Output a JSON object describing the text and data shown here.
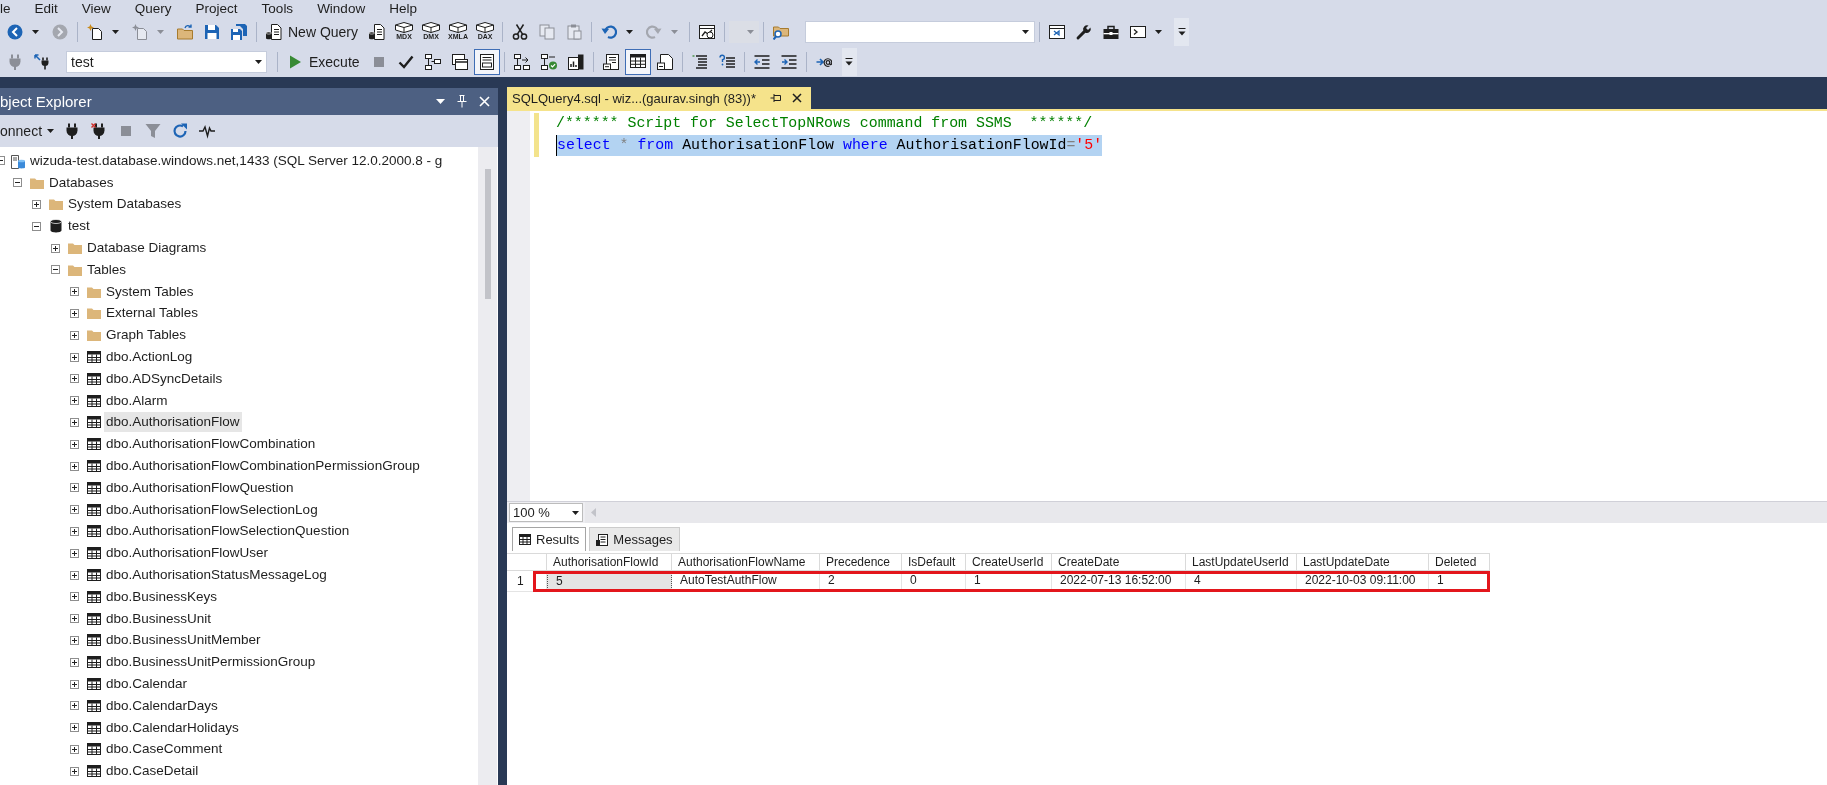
{
  "menu_bar": {
    "items": [
      "le",
      "Edit",
      "View",
      "Query",
      "Project",
      "Tools",
      "Window",
      "Help"
    ]
  },
  "toolbar_1": {
    "groups": [
      [
        {
          "kind": "back",
          "disabled": false
        },
        {
          "kind": "forward",
          "disabled": true
        }
      ],
      [
        {
          "kind": "newproject",
          "disabled": false
        },
        {
          "kind": "additem",
          "disabled": true
        },
        {
          "kind": "open",
          "disabled": false
        },
        {
          "kind": "save",
          "disabled": false
        },
        {
          "kind": "saveall",
          "disabled": false
        }
      ],
      [
        {
          "kind": "newquery",
          "label": "New Query",
          "disabled": false
        },
        {
          "kind": "query",
          "disabled": false
        },
        {
          "kind": "cube",
          "label": "MDX",
          "disabled": false
        },
        {
          "kind": "cube",
          "label": "DMX",
          "disabled": false
        },
        {
          "kind": "cube",
          "label": "XMLA",
          "disabled": false
        },
        {
          "kind": "cube",
          "label": "DAX",
          "disabled": false
        }
      ],
      [
        {
          "kind": "cut",
          "disabled": false
        },
        {
          "kind": "copy",
          "disabled": true
        },
        {
          "kind": "paste",
          "disabled": true
        }
      ],
      [
        {
          "kind": "undo",
          "disabled": false
        },
        {
          "kind": "redo",
          "disabled": true
        }
      ],
      [
        {
          "kind": "monitor",
          "disabled": false
        }
      ],
      [
        {
          "kind": "dropdown",
          "disabled": true
        }
      ],
      [
        {
          "kind": "find",
          "disabled": false
        },
        {
          "kind": "combo",
          "disabled": false
        }
      ],
      [
        {
          "kind": "window",
          "disabled": false
        },
        {
          "kind": "wrench",
          "disabled": false
        },
        {
          "kind": "toolbox",
          "disabled": false
        },
        {
          "kind": "terminal",
          "disabled": false
        }
      ]
    ]
  },
  "toolbar_2": {
    "groups": [
      [
        {
          "kind": "connect",
          "disabled": true,
          "on": false
        },
        {
          "kind": "changeconnection",
          "disabled": false,
          "on": false
        },
        {
          "kind": "database",
          "value": "test",
          "disabled": false
        }
      ],
      [
        {
          "kind": "execute",
          "label": "Execute",
          "disabled": false,
          "on": false
        },
        {
          "kind": "stop",
          "disabled": true,
          "on": false
        },
        {
          "kind": "parse",
          "disabled": false,
          "on": false
        },
        {
          "kind": "plan",
          "disabled": false,
          "on": false
        },
        {
          "kind": "options",
          "disabled": false,
          "on": false
        },
        {
          "kind": "intellisense",
          "disabled": false,
          "on": true
        }
      ],
      [
        {
          "kind": "actualplan",
          "disabled": false,
          "on": false
        },
        {
          "kind": "livestats",
          "disabled": false,
          "on": false
        },
        {
          "kind": "clientstats",
          "disabled": false,
          "on": false
        }
      ],
      [
        {
          "kind": "totext",
          "disabled": false,
          "on": false
        },
        {
          "kind": "togrid",
          "disabled": false,
          "on": true
        },
        {
          "kind": "tofile",
          "disabled": false,
          "on": false
        }
      ],
      [
        {
          "kind": "comment",
          "disabled": false,
          "on": false
        },
        {
          "kind": "uncomment",
          "disabled": false,
          "on": false
        }
      ],
      [
        {
          "kind": "outdent",
          "disabled": false,
          "on": false
        },
        {
          "kind": "indent",
          "disabled": false,
          "on": false
        }
      ],
      [
        {
          "kind": "template",
          "disabled": false,
          "on": false
        }
      ]
    ]
  },
  "object_explorer": {
    "title": "bject Explorer",
    "toolbar": {
      "connect_label": "onnect",
      "items": [
        {
          "kind": "connect",
          "disabled": false
        },
        {
          "kind": "disconnect",
          "disabled": false
        },
        {
          "kind": "stop",
          "disabled": true
        },
        {
          "kind": "filter",
          "disabled": true
        },
        {
          "kind": "refresh",
          "disabled": false
        },
        {
          "kind": "activity",
          "disabled": false
        }
      ]
    },
    "tree": [
      {
        "label": "wizuda-test.database.windows.net,1433 (SQL Server 12.0.2000.8 - g",
        "kind": "server",
        "expanded": true,
        "selected": false,
        "children": [
          {
            "label": "Databases",
            "kind": "folder",
            "expanded": true,
            "selected": false,
            "children": [
              {
                "label": "System Databases",
                "kind": "folder",
                "expanded": false,
                "selected": false
              },
              {
                "label": "test",
                "kind": "database",
                "expanded": true,
                "selected": false,
                "children": [
                  {
                    "label": "Database Diagrams",
                    "kind": "folder",
                    "expanded": false,
                    "selected": false
                  },
                  {
                    "label": "Tables",
                    "kind": "folder",
                    "expanded": true,
                    "selected": false,
                    "children": [
                      {
                        "label": "System Tables",
                        "kind": "folder",
                        "expanded": false,
                        "selected": false
                      },
                      {
                        "label": "External Tables",
                        "kind": "folder",
                        "expanded": false,
                        "selected": false
                      },
                      {
                        "label": "Graph Tables",
                        "kind": "folder",
                        "expanded": false,
                        "selected": false
                      },
                      {
                        "label": "dbo.ActionLog",
                        "kind": "table",
                        "expanded": false,
                        "selected": false
                      },
                      {
                        "label": "dbo.ADSyncDetails",
                        "kind": "table",
                        "expanded": false,
                        "selected": false
                      },
                      {
                        "label": "dbo.Alarm",
                        "kind": "table",
                        "expanded": false,
                        "selected": false
                      },
                      {
                        "label": "dbo.AuthorisationFlow",
                        "kind": "table",
                        "expanded": false,
                        "selected": true
                      },
                      {
                        "label": "dbo.AuthorisationFlowCombination",
                        "kind": "table",
                        "expanded": false,
                        "selected": false
                      },
                      {
                        "label": "dbo.AuthorisationFlowCombinationPermissionGroup",
                        "kind": "table",
                        "expanded": false,
                        "selected": false
                      },
                      {
                        "label": "dbo.AuthorisationFlowQuestion",
                        "kind": "table",
                        "expanded": false,
                        "selected": false
                      },
                      {
                        "label": "dbo.AuthorisationFlowSelectionLog",
                        "kind": "table",
                        "expanded": false,
                        "selected": false
                      },
                      {
                        "label": "dbo.AuthorisationFlowSelectionQuestion",
                        "kind": "table",
                        "expanded": false,
                        "selected": false
                      },
                      {
                        "label": "dbo.AuthorisationFlowUser",
                        "kind": "table",
                        "expanded": false,
                        "selected": false
                      },
                      {
                        "label": "dbo.AuthorisationStatusMessageLog",
                        "kind": "table",
                        "expanded": false,
                        "selected": false
                      },
                      {
                        "label": "dbo.BusinessKeys",
                        "kind": "table",
                        "expanded": false,
                        "selected": false
                      },
                      {
                        "label": "dbo.BusinessUnit",
                        "kind": "table",
                        "expanded": false,
                        "selected": false
                      },
                      {
                        "label": "dbo.BusinessUnitMember",
                        "kind": "table",
                        "expanded": false,
                        "selected": false
                      },
                      {
                        "label": "dbo.BusinessUnitPermissionGroup",
                        "kind": "table",
                        "expanded": false,
                        "selected": false
                      },
                      {
                        "label": "dbo.Calendar",
                        "kind": "table",
                        "expanded": false,
                        "selected": false
                      },
                      {
                        "label": "dbo.CalendarDays",
                        "kind": "table",
                        "expanded": false,
                        "selected": false
                      },
                      {
                        "label": "dbo.CalendarHolidays",
                        "kind": "table",
                        "expanded": false,
                        "selected": false
                      },
                      {
                        "label": "dbo.CaseComment",
                        "kind": "table",
                        "expanded": false,
                        "selected": false
                      },
                      {
                        "label": "dbo.CaseDetail",
                        "kind": "table",
                        "expanded": false,
                        "selected": false
                      }
                    ]
                  }
                ]
              }
            ]
          }
        ]
      }
    ]
  },
  "document_tabs": [
    {
      "title": "SQLQuery4.sql - wiz...(gaurav.singh (83))*",
      "selected": true
    }
  ],
  "editor": {
    "lines": [
      {
        "changed": true,
        "selected": false,
        "tokens": [
          {
            "text": "/****** Script for SelectTopNRows command from SSMS  ******/",
            "kind": "comment"
          }
        ]
      },
      {
        "changed": true,
        "selected": true,
        "tokens": [
          {
            "text": "select ",
            "kind": "keyword"
          },
          {
            "text": "* ",
            "kind": "operator"
          },
          {
            "text": "from ",
            "kind": "keyword"
          },
          {
            "text": "AuthorisationFlow ",
            "kind": "plain"
          },
          {
            "text": "where ",
            "kind": "keyword"
          },
          {
            "text": "AuthorisationFlowId",
            "kind": "plain"
          },
          {
            "text": "=",
            "kind": "operator"
          },
          {
            "text": "'5'",
            "kind": "string"
          }
        ]
      }
    ],
    "zoom": "100 %"
  },
  "results": {
    "tabs": [
      {
        "label": "Results",
        "kind": "grid",
        "selected": true
      },
      {
        "label": "Messages",
        "kind": "messages",
        "selected": false
      }
    ],
    "grid": {
      "columns": [
        "AuthorisationFlowId",
        "AuthorisationFlowName",
        "Precedence",
        "IsDefault",
        "CreateUserId",
        "CreateDate",
        "LastUpdateUserId",
        "LastUpdateDate",
        "Deleted"
      ],
      "rows": [
        {
          "number": "1",
          "outlined": true,
          "cells": [
            {
              "text": "5",
              "selected": true
            },
            {
              "text": "AutoTestAuthFlow",
              "selected": false
            },
            {
              "text": "2",
              "selected": false
            },
            {
              "text": "0",
              "selected": false
            },
            {
              "text": "1",
              "selected": false
            },
            {
              "text": "2022-07-13 16:52:00",
              "selected": false
            },
            {
              "text": "4",
              "selected": false
            },
            {
              "text": "2022-10-03 09:11:00",
              "selected": false
            },
            {
              "text": "1",
              "selected": false
            }
          ]
        }
      ]
    }
  }
}
